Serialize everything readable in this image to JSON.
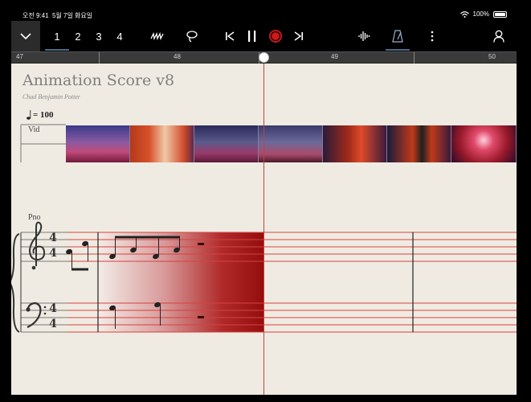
{
  "status_bar": {
    "time": "오전 9:41",
    "date": "5월 7일 화요일",
    "battery": "100%"
  },
  "toolbar": {
    "staff_numbers": [
      "1",
      "2",
      "3",
      "4"
    ],
    "icons": [
      "menu-chevron-icon",
      "pen-icon",
      "lasso-icon",
      "skip-back-icon",
      "pause-icon",
      "record-icon",
      "skip-forward-icon",
      "waveform-icon",
      "metronome-icon",
      "more-icon",
      "account-icon"
    ]
  },
  "ruler": {
    "bars": [
      "47",
      "48",
      "49",
      "50"
    ]
  },
  "score": {
    "title": "Animation Score v8",
    "composer": "Chad Benjamin Potter",
    "tempo_value": "= 100",
    "instruments": {
      "video": "Vid",
      "piano": "Pno"
    },
    "time_signature": {
      "top": "4",
      "bottom": "4"
    }
  },
  "colors": {
    "accent_red": "#d01818",
    "paper": "#efebe2",
    "staff_red": "#d84040"
  }
}
